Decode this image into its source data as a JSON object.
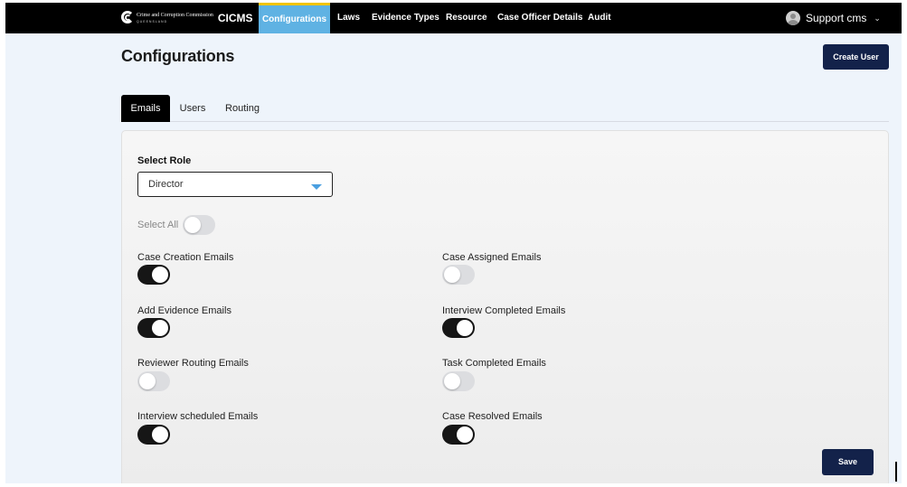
{
  "nav": {
    "logo": {
      "org": "Crime and Corruption Commission",
      "sub": "QUEENSLAND",
      "app": "CICMS"
    },
    "tabs": [
      {
        "label": "Configurations",
        "active": true
      },
      {
        "label": "Laws",
        "active": false
      },
      {
        "label": "Evidence Types",
        "active": false
      },
      {
        "label": "Resource",
        "active": false
      },
      {
        "label": "Case Officer Details",
        "active": false
      },
      {
        "label": "Audit",
        "active": false
      }
    ],
    "user": {
      "name": "Support cms",
      "avatar_icon": "user-avatar-icon",
      "chevron_icon": "chevron-down-icon"
    }
  },
  "page": {
    "title": "Configurations",
    "create_user_label": "Create User"
  },
  "tabs": [
    {
      "label": "Emails",
      "active": true
    },
    {
      "label": "Users",
      "active": false
    },
    {
      "label": "Routing",
      "active": false
    }
  ],
  "form": {
    "role_label": "Select Role",
    "role_value": "Director",
    "select_all_label": "Select All",
    "select_all_on": false,
    "options": [
      {
        "label": "Case Creation Emails",
        "on": true
      },
      {
        "label": "Case Assigned Emails",
        "on": false
      },
      {
        "label": "Add Evidence Emails",
        "on": true
      },
      {
        "label": "Interview Completed Emails",
        "on": true
      },
      {
        "label": "Reviewer Routing Emails",
        "on": false
      },
      {
        "label": "Task Completed Emails",
        "on": false
      },
      {
        "label": "Interview scheduled Emails",
        "on": true
      },
      {
        "label": "Case Resolved Emails",
        "on": true
      }
    ],
    "save_label": "Save"
  },
  "colors": {
    "nav_bg": "#000000",
    "active_tab_bg": "#5fb2e3",
    "active_tab_accent": "#f3c400",
    "primary_button": "#13224a",
    "toggle_on": "#161616",
    "toggle_off": "#dcdde0",
    "page_bg": "#eef4fb"
  }
}
